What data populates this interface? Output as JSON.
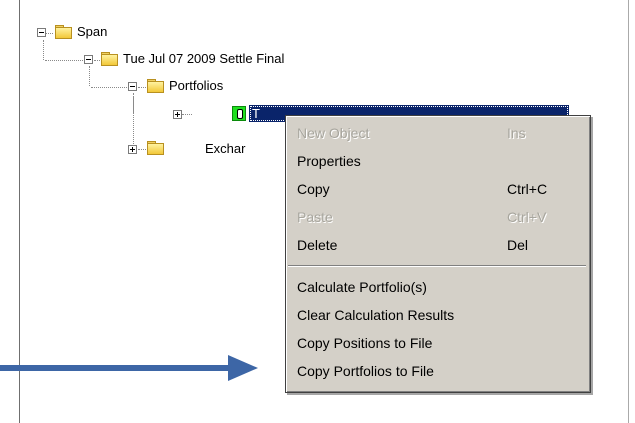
{
  "tree": {
    "root": {
      "label": "Span",
      "expander": "minus"
    },
    "settle": {
      "label": "Tue Jul 07 2009 Settle Final",
      "expander": "minus"
    },
    "portfolios": {
      "label": "Portfolios",
      "expander": "minus"
    },
    "selected_node": {
      "label": "T",
      "expander": "plus",
      "icon": "portfolio-icon"
    },
    "exchanges": {
      "label": "Exchar",
      "expander": "plus"
    }
  },
  "context_menu": {
    "items": [
      {
        "label": "New Object",
        "shortcut": "Ins",
        "disabled": true
      },
      {
        "label": "Properties",
        "shortcut": "",
        "disabled": false
      },
      {
        "label": "Copy",
        "shortcut": "Ctrl+C",
        "disabled": false
      },
      {
        "label": "Paste",
        "shortcut": "Ctrl+V",
        "disabled": true
      },
      {
        "label": "Delete",
        "shortcut": "Del",
        "disabled": false
      },
      {
        "label": "Calculate Portfolio(s)",
        "shortcut": "",
        "disabled": false
      },
      {
        "label": "Clear Calculation Results",
        "shortcut": "",
        "disabled": false
      },
      {
        "label": "Copy Positions to File",
        "shortcut": "",
        "disabled": false
      },
      {
        "label": "Copy Portfolios to File",
        "shortcut": "",
        "disabled": false
      }
    ]
  },
  "annotation": {
    "arrow_color": "#3d66a6",
    "points_to": "Copy Portfolios to File"
  },
  "colors": {
    "selection": "#0a246a",
    "menu_bg": "#d4d0c8",
    "folder": "#f2c838",
    "portfolio_icon": "#20e020"
  }
}
